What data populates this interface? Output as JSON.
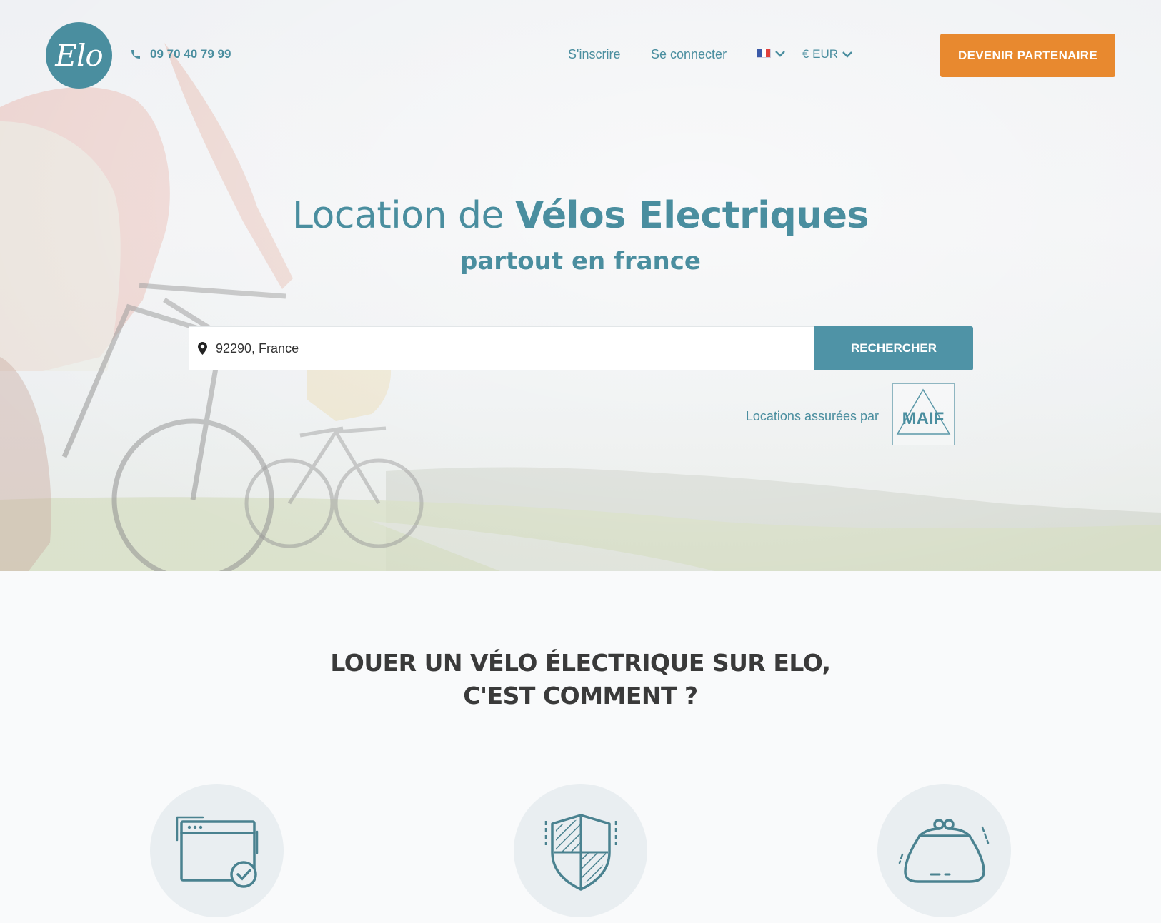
{
  "brand": {
    "logo_text": "Elo",
    "accent": "#4a8e9f",
    "cta_color": "#e8892f"
  },
  "header": {
    "phone": "09 70 40 79 99",
    "signup": "S'inscrire",
    "login": "Se connecter",
    "language_icon": "france-flag-icon",
    "currency": "€ EUR",
    "partner_button": "DEVENIR PARTENAIRE"
  },
  "hero": {
    "title_prefix": "Location de",
    "title_strong": "Vélos Electriques",
    "subtitle": "partout en france",
    "search": {
      "value": "92290, France",
      "button": "RECHERCHER",
      "icon": "map-pin-icon"
    },
    "insured_label": "Locations assurées par",
    "insurer": "MAIF"
  },
  "how_it_works": {
    "title_line1": "LOUER UN VÉLO ÉLECTRIQUE SUR ELO,",
    "title_line2": "C'EST COMMENT ?",
    "features": [
      {
        "icon": "browser-check-icon"
      },
      {
        "icon": "shield-icon"
      },
      {
        "icon": "purse-icon"
      }
    ]
  }
}
